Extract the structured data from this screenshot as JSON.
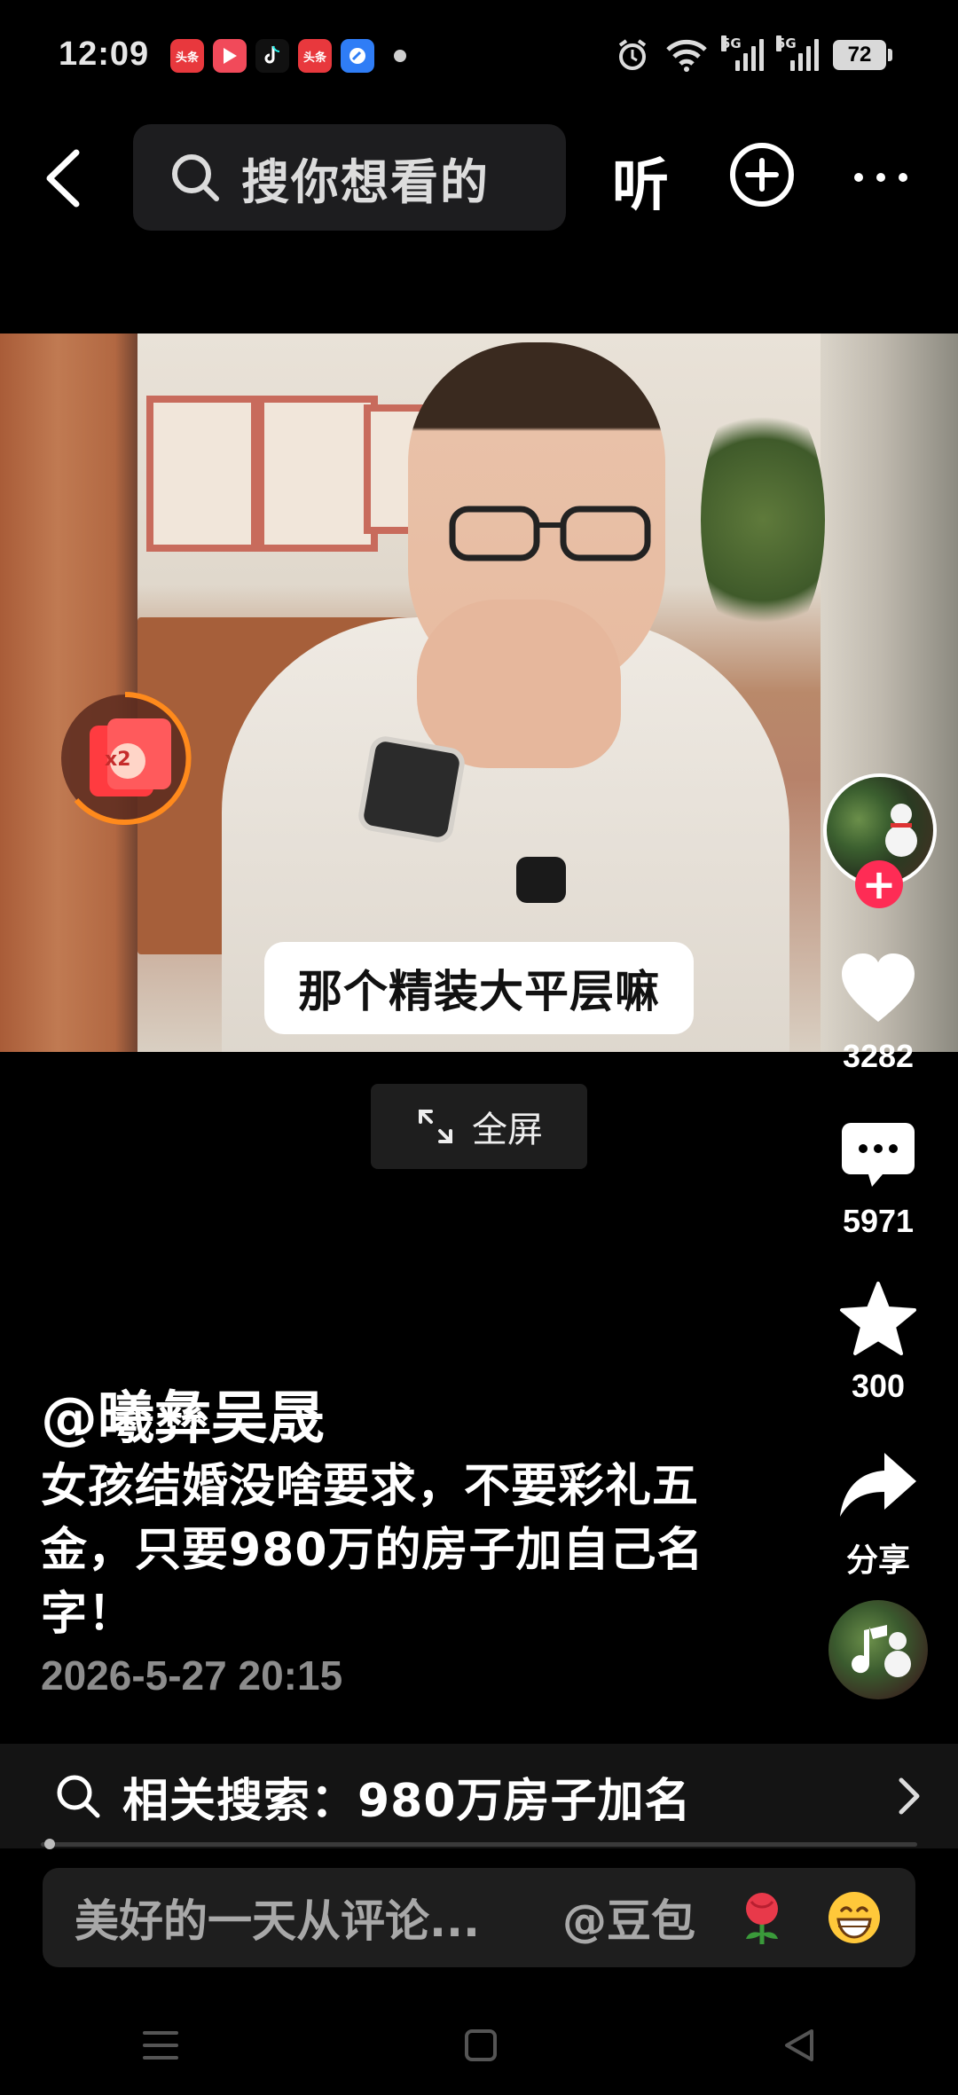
{
  "status_bar": {
    "time": "12:09",
    "apps": [
      {
        "name": "toutiao-icon",
        "text": "头条",
        "color": "#e8383d"
      },
      {
        "name": "video-player-icon",
        "text": "",
        "color": "#f14a5a"
      },
      {
        "name": "tiktok-icon",
        "text": "",
        "color": "#111111"
      },
      {
        "name": "toutiao-icon-2",
        "text": "头条",
        "color": "#e8383d"
      },
      {
        "name": "browser-icon",
        "text": "",
        "color": "#2f7df6"
      }
    ],
    "signal_1": "5G",
    "signal_2": "5G",
    "battery": "72"
  },
  "top_nav": {
    "search_placeholder": "搜你想看的",
    "listen_label": "听"
  },
  "video": {
    "caption": "那个精装大平层嘛",
    "red_packet_badge": "x2",
    "fullscreen_label": "全屏"
  },
  "rail": {
    "likes": "3282",
    "comments": "5971",
    "favorites": "300",
    "share_label": "分享"
  },
  "post": {
    "author": "@曦彝吴晟",
    "description": "女孩结婚没啥要求，不要彩礼五金，只要980万的房子加自己名字！",
    "date": "2026-5-27 20:15",
    "progress": 0.01
  },
  "related_search": {
    "label": "相关搜索：980万房子加名"
  },
  "comment_bar": {
    "placeholder": "美好的一天从评论...",
    "mention": "@豆包"
  },
  "colors": {
    "accent_red": "#fe2c55",
    "ring_orange": "#ff8a1c"
  }
}
